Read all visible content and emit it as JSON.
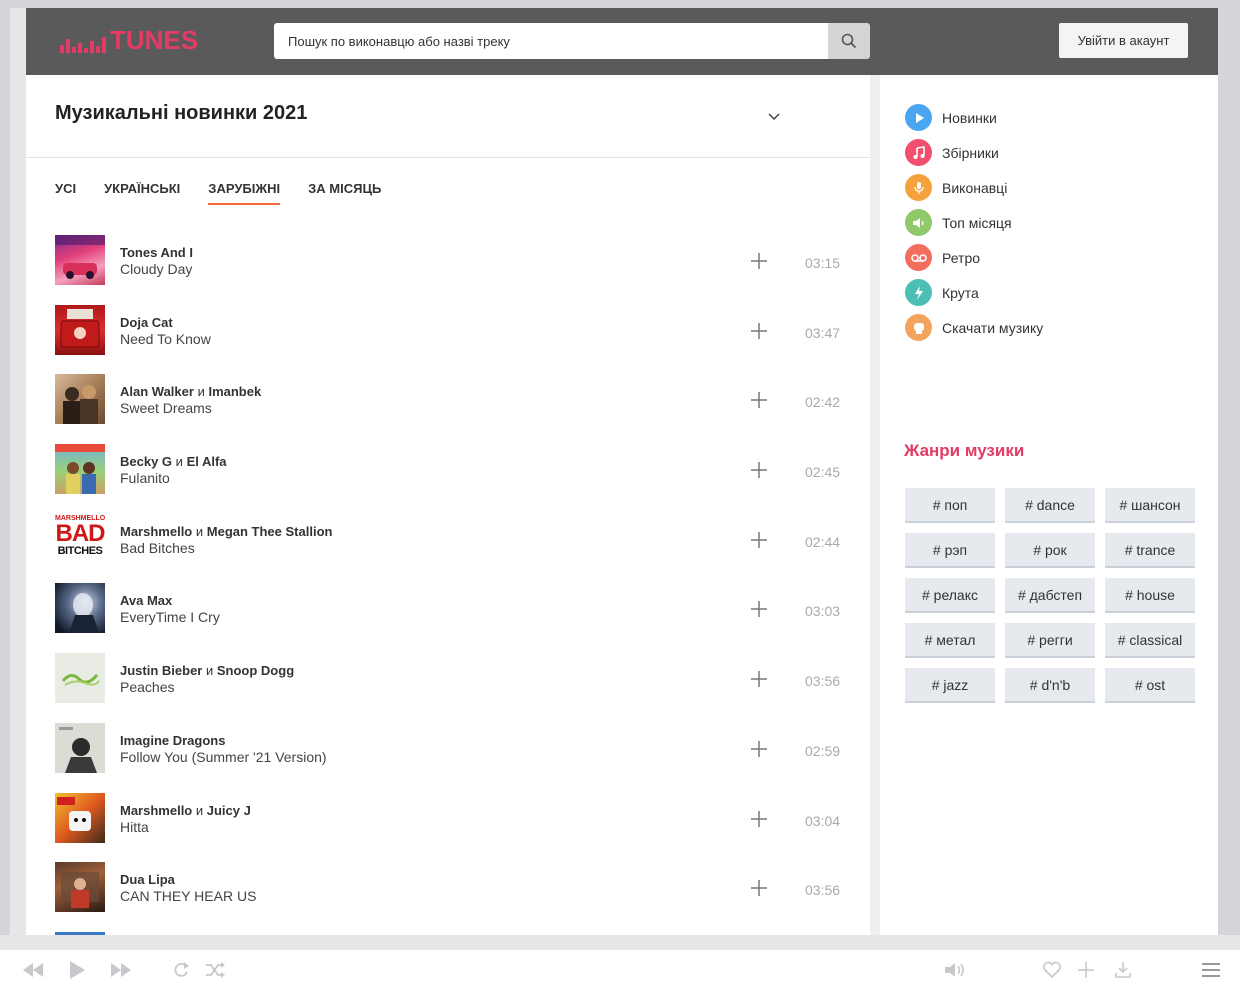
{
  "header": {
    "logo_text": "TUNES",
    "search_placeholder": "Пошук по виконавцю або назві треку",
    "login_label": "Увійти в акаунт"
  },
  "main": {
    "title": "Музикальні новинки 2021",
    "tabs": [
      {
        "label": "УСІ",
        "active": false
      },
      {
        "label": "УКРАЇНСЬКІ",
        "active": false
      },
      {
        "label": "ЗАРУБІЖНІ",
        "active": true
      },
      {
        "label": "ЗА МІСЯЦЬ",
        "active": false
      }
    ],
    "tracks": [
      {
        "artist1": "Tones And I",
        "conj": "",
        "artist2": "",
        "song": "Cloudy Day",
        "duration": "03:15"
      },
      {
        "artist1": "Doja Cat",
        "conj": "",
        "artist2": "",
        "song": "Need To Know",
        "duration": "03:47"
      },
      {
        "artist1": "Alan Walker",
        "conj": "и",
        "artist2": "Imanbek",
        "song": "Sweet Dreams",
        "duration": "02:42"
      },
      {
        "artist1": "Becky G",
        "conj": "и",
        "artist2": "El Alfa",
        "song": "Fulanito",
        "duration": "02:45"
      },
      {
        "artist1": "Marshmello",
        "conj": "и",
        "artist2": "Megan Thee Stallion",
        "song": "Bad Bitches",
        "duration": "02:44",
        "cover_text_top": "MARSHMELLO",
        "cover_text_big": "BAD",
        "cover_text_bottom": "BITCHES"
      },
      {
        "artist1": "Ava Max",
        "conj": "",
        "artist2": "",
        "song": "EveryTime I Cry",
        "duration": "03:03"
      },
      {
        "artist1": "Justin Bieber",
        "conj": "и",
        "artist2": "Snoop Dogg",
        "song": "Peaches",
        "duration": "03:56"
      },
      {
        "artist1": "Imagine Dragons",
        "conj": "",
        "artist2": "",
        "song": "Follow You (Summer '21 Version)",
        "duration": "02:59"
      },
      {
        "artist1": "Marshmello",
        "conj": "и",
        "artist2": "Juicy J",
        "song": "Hitta",
        "duration": "03:04"
      },
      {
        "artist1": "Dua Lipa",
        "conj": "",
        "artist2": "",
        "song": "CAN THEY HEAR US",
        "duration": "03:56"
      }
    ]
  },
  "sidebar": {
    "categories": [
      {
        "label": "Новинки",
        "icon": "play-icon",
        "color": "#4aa6f0"
      },
      {
        "label": "Збірники",
        "icon": "music-note-icon",
        "color": "#f0506e"
      },
      {
        "label": "Виконавці",
        "icon": "microphone-icon",
        "color": "#f6a23c"
      },
      {
        "label": "Топ місяця",
        "icon": "speaker-icon",
        "color": "#8fc96a"
      },
      {
        "label": "Ретро",
        "icon": "cassette-icon",
        "color": "#f26d5b"
      },
      {
        "label": "Крута",
        "icon": "lightning-icon",
        "color": "#4cbfb5"
      },
      {
        "label": "Скачати музику",
        "icon": "download-badge-icon",
        "color": "#f4a35e"
      }
    ],
    "genres_title": "Жанри музики",
    "genres": [
      "# поп",
      "# dance",
      "# шансон",
      "# рэп",
      "# рок",
      "# trance",
      "# релакс",
      "# дабстеп",
      "# house",
      "# метал",
      "# регги",
      "# classical",
      "# jazz",
      "# d'n'b",
      "# ost"
    ]
  },
  "colors": {
    "accent": "#e23c64",
    "tab_underline": "#f0673a",
    "header_bg": "#5a5a5c"
  }
}
